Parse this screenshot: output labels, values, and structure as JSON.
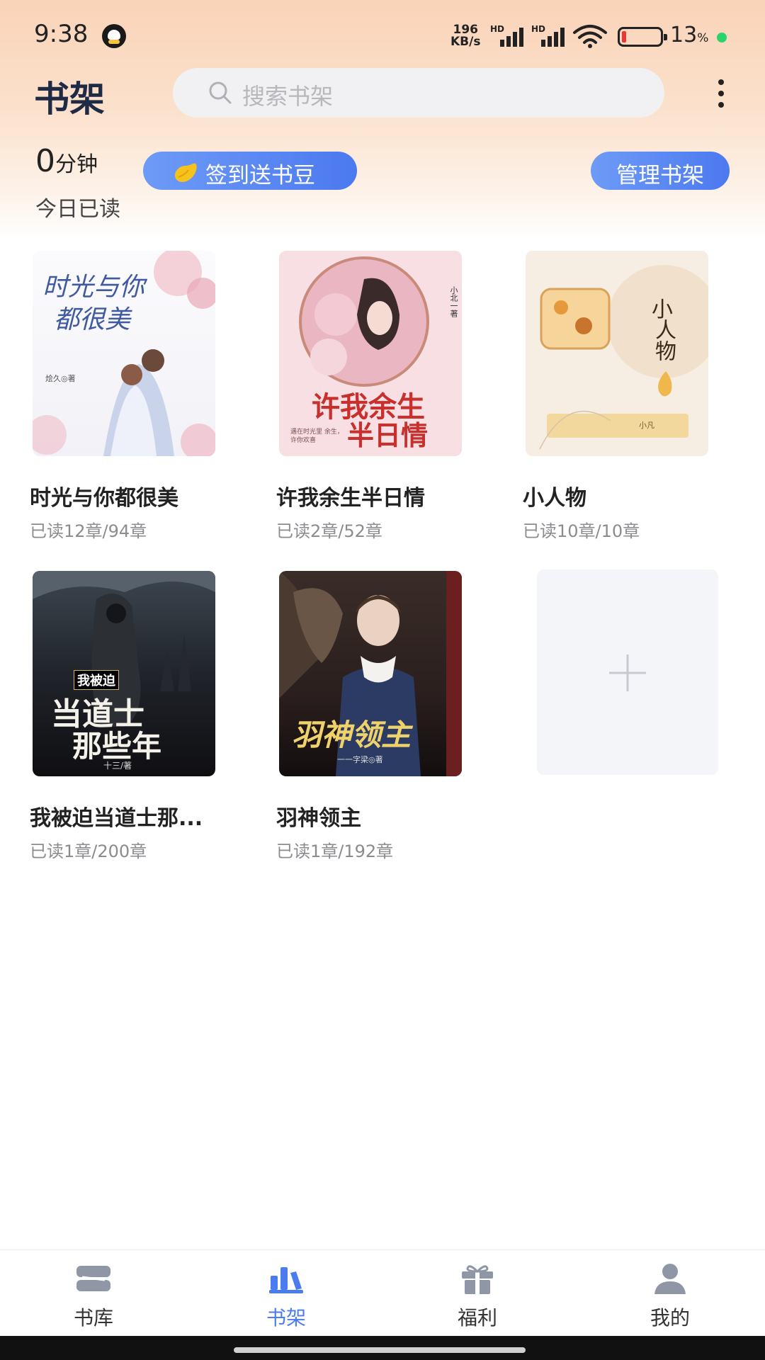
{
  "status_bar": {
    "time": "9:38",
    "net_speed_value": "196",
    "net_speed_unit": "KB/s",
    "hd1": "HD",
    "hd2": "HD",
    "battery_value": "13",
    "battery_unit": "%",
    "battery_color": "#e53935",
    "charging_dot_color": "#2bd36b"
  },
  "header": {
    "title": "书架",
    "search_placeholder": "搜索书架",
    "more_icon": "more-vertical-icon"
  },
  "reading": {
    "minutes": "0",
    "minutes_unit": "分钟",
    "today_label": "今日已读",
    "checkin_label": "签到送书豆",
    "manage_label": "管理书架"
  },
  "books": [
    {
      "title": "时光与你都很美",
      "progress": "已读12章/94章",
      "cover_title_line1": "时光与你",
      "cover_title_line2": "都很美",
      "cover_author": "烩久◎著"
    },
    {
      "title": "许我余生半日情",
      "progress": "已读2章/52章",
      "cover_title_line1": "许我余生",
      "cover_title_line2": "半日情",
      "cover_author": "小北一著",
      "cover_tagline": "遇在时光里 余生，许你欢喜"
    },
    {
      "title": "小人物",
      "progress": "已读10章/10章",
      "cover_title_line1": "小",
      "cover_title_line2": "人物",
      "cover_author": "小凡"
    },
    {
      "title": "我被迫当道士那...",
      "progress": "已读1章/200章",
      "cover_badge": "我被迫",
      "cover_title_line1": "当道士",
      "cover_title_line2": "那些年",
      "cover_author": "十三/著"
    },
    {
      "title": "羽神领主",
      "progress": "已读1章/192章",
      "cover_title_line1": "羽神领主",
      "cover_author": "一一字梁◎著"
    }
  ],
  "add_book_icon": "plus-icon",
  "bottom_nav": [
    {
      "label": "书库",
      "icon": "library-icon",
      "active": false
    },
    {
      "label": "书架",
      "icon": "bookshelf-icon",
      "active": true
    },
    {
      "label": "福利",
      "icon": "gift-icon",
      "active": false
    },
    {
      "label": "我的",
      "icon": "user-icon",
      "active": false
    }
  ],
  "colors": {
    "accent": "#4a7bf0",
    "button_gradient_start": "#6e9bf7",
    "button_gradient_end": "#4b79ef",
    "header_gradient": "#fad3b8",
    "nav_inactive": "#8f96a6"
  }
}
